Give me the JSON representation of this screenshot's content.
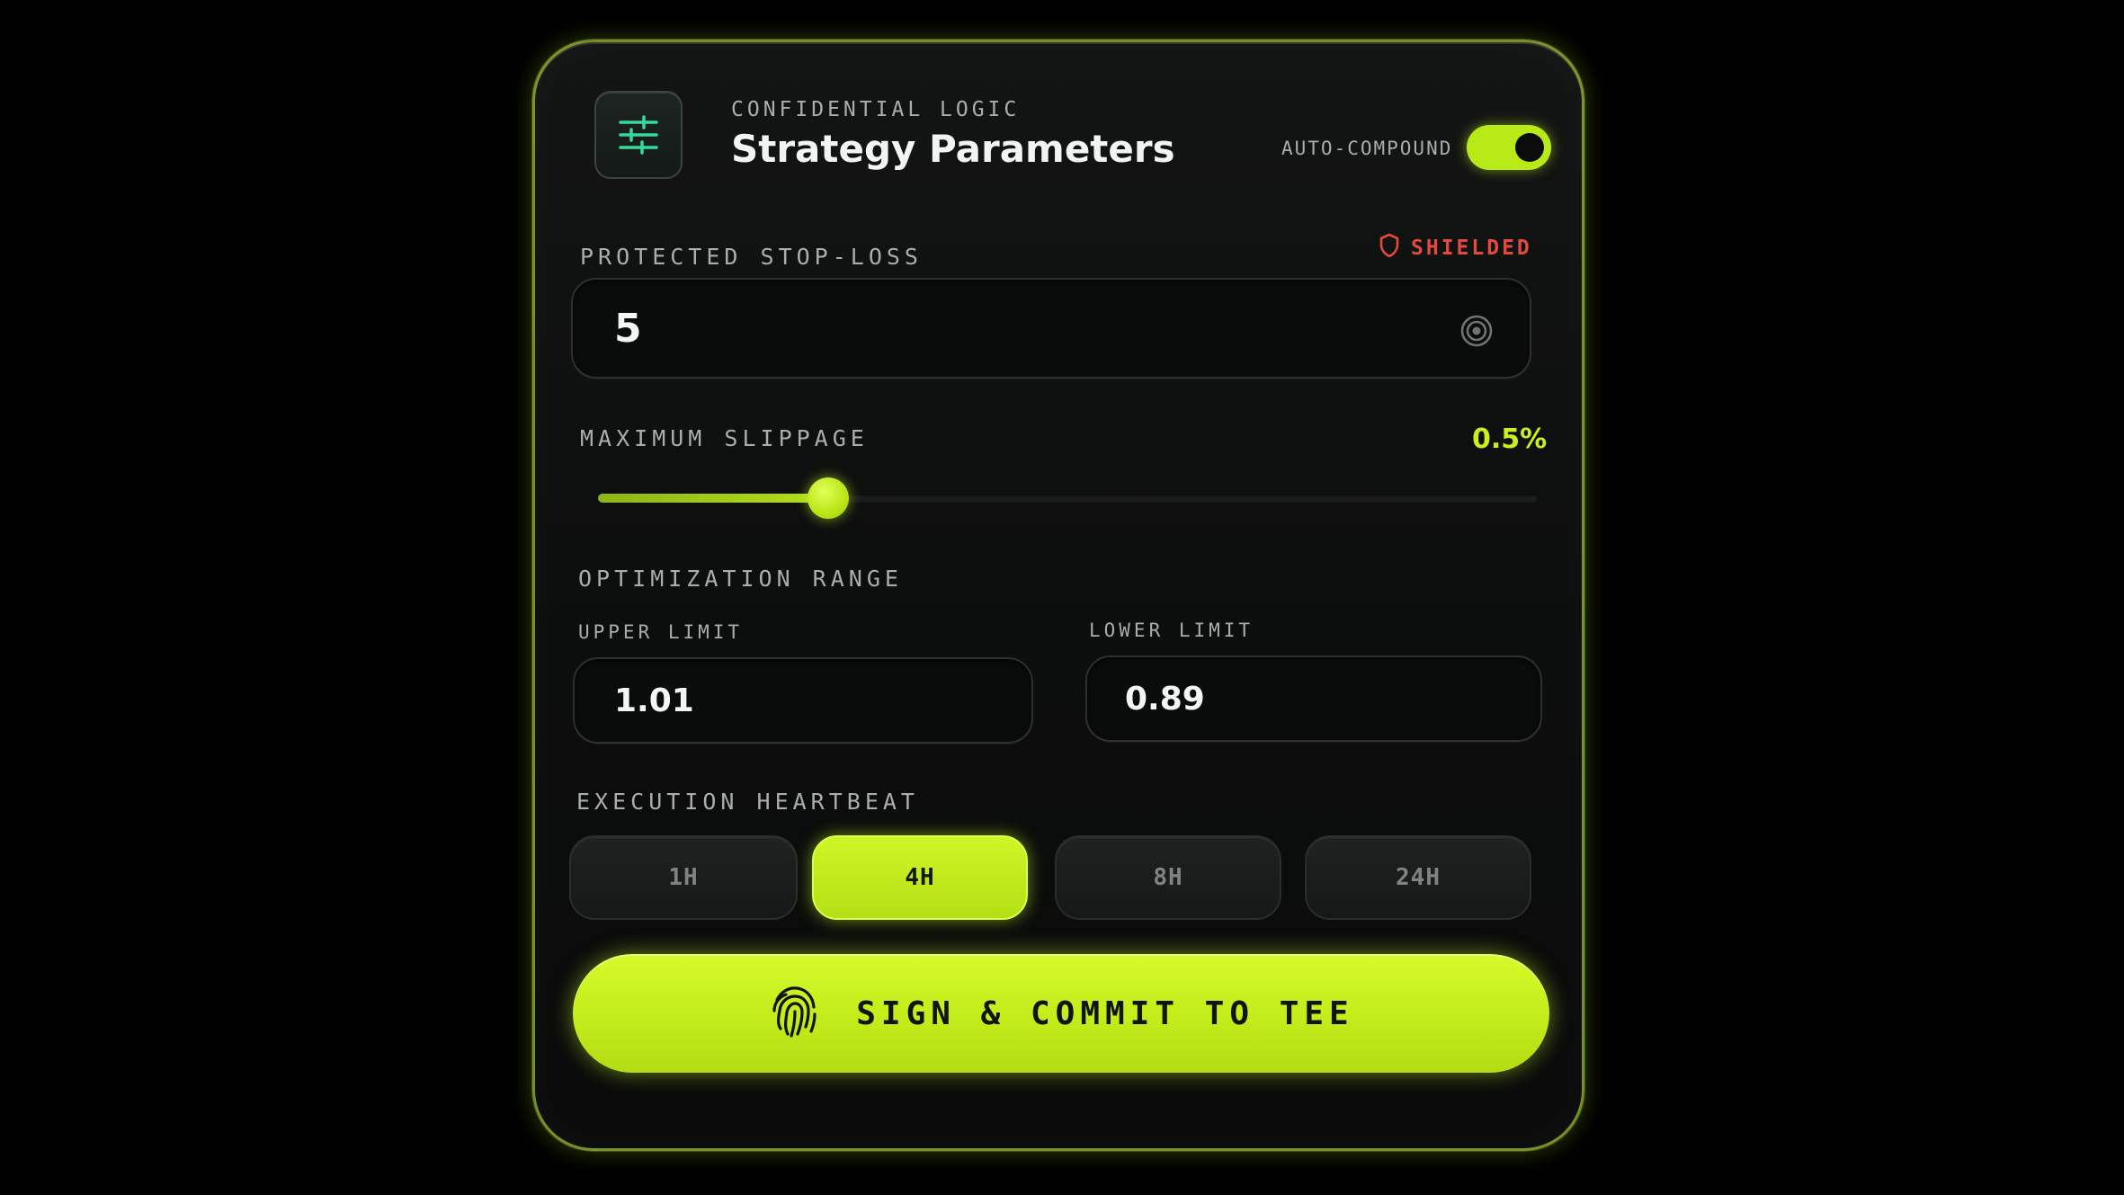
{
  "header": {
    "eyebrow": "CONFIDENTIAL LOGIC",
    "title": "Strategy Parameters",
    "icon": "sliders-icon",
    "toggle": {
      "label": "AUTO-COMPOUND",
      "on": true
    }
  },
  "stop_loss": {
    "label": "PROTECTED STOP-LOSS",
    "badge": "SHIELDED",
    "badge_icon": "shield-icon",
    "value": "5",
    "icon": "target-icon"
  },
  "slippage": {
    "label": "MAXIMUM SLIPPAGE",
    "value_text": "0.5%",
    "fraction": 0.245
  },
  "optimization": {
    "label": "OPTIMIZATION RANGE",
    "upper": {
      "label": "UPPER LIMIT",
      "value": "1.01"
    },
    "lower": {
      "label": "LOWER LIMIT",
      "value": "0.89"
    }
  },
  "heartbeat": {
    "label": "EXECUTION HEARTBEAT",
    "options": [
      "1H",
      "4H",
      "8H",
      "24H"
    ],
    "selected": "4H"
  },
  "submit": {
    "label": "SIGN & COMMIT TO TEE",
    "icon": "fingerprint-icon"
  },
  "colors": {
    "accent": "#c2ec1a",
    "danger": "#e24a3d",
    "icon_green": "#36d99a",
    "background": "#000000"
  }
}
